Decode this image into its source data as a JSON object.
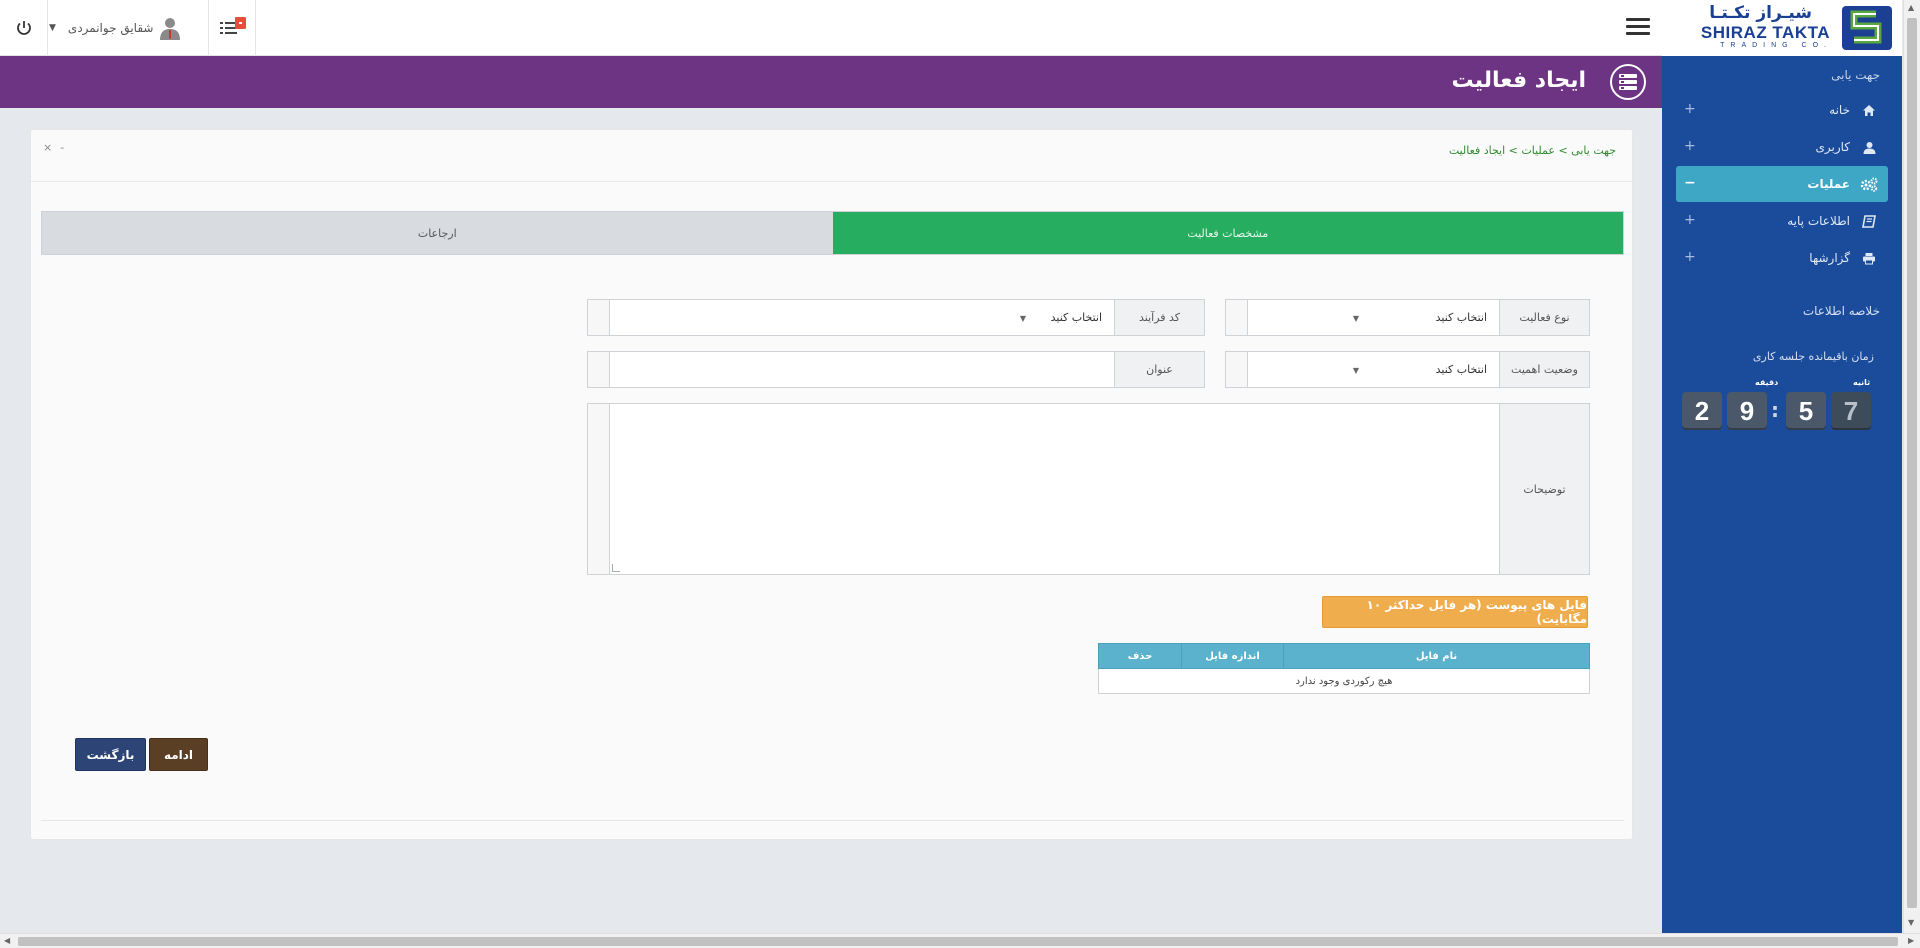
{
  "header": {
    "user_name": "شقایق جوانمردی"
  },
  "title_bar": {
    "title": "ایجاد فعالیت"
  },
  "sidebar": {
    "logo": {
      "fa": "شیـراز تکـتـا",
      "en": "SHIRAZ TAKTA",
      "sub": "TRADING CO."
    },
    "nav_title": "جهت یابی",
    "items": [
      {
        "label": "خانه",
        "icon": "home-icon",
        "toggle": "+"
      },
      {
        "label": "کاربری",
        "icon": "user-icon",
        "toggle": "+"
      },
      {
        "label": "عملیات",
        "icon": "gears-icon",
        "toggle": "−"
      },
      {
        "label": "اطلاعات پایه",
        "icon": "book-icon",
        "toggle": "+"
      },
      {
        "label": "گزارشها",
        "icon": "printer-icon",
        "toggle": "+"
      }
    ],
    "summary_title": "خلاصه اطلاعات",
    "timer": {
      "title": "زمان باقیمانده جلسه کاری",
      "minutes_label": "دقیقه",
      "seconds_label": "ثانیه",
      "m1": "2",
      "m2": "9",
      "s1": "5",
      "s2": "7"
    }
  },
  "card": {
    "breadcrumb": "جهت یابی > عملیات > ایجاد فعالیت",
    "tools": {
      "close": "×",
      "minimize": "-"
    },
    "tabs": [
      {
        "label": "مشخصات فعالیت",
        "active": true
      },
      {
        "label": "ارجاعات",
        "active": false
      }
    ],
    "form": {
      "activity_type": {
        "label": "نوع فعالیت",
        "value": "انتخاب کنید"
      },
      "process_code": {
        "label": "کد فرآیند",
        "value": "انتخاب کنید"
      },
      "importance_status": {
        "label": "وضعیت اهمیت",
        "value": "انتخاب کنید"
      },
      "subject": {
        "label": "عنوان",
        "value": ""
      },
      "description": {
        "label": "توضیحات",
        "value": ""
      }
    },
    "attach_button": "فایل های پیوست (هر فایل حداکثر ۱۰ مگابایت)",
    "files_table": {
      "columns": [
        "نام فایل",
        "اندازه فایل",
        "حذف"
      ],
      "empty_message": "هیچ رکوردی وجود ندارد"
    },
    "buttons": {
      "continue": "ادامه",
      "back": "بازگشت"
    }
  },
  "colors": {
    "title_bar": "#6d3483",
    "sidebar": "#1b4c9b",
    "active_tab": "#26ad5f",
    "active_nav": "#3fa7c6",
    "attach": "#f0ad4e"
  }
}
